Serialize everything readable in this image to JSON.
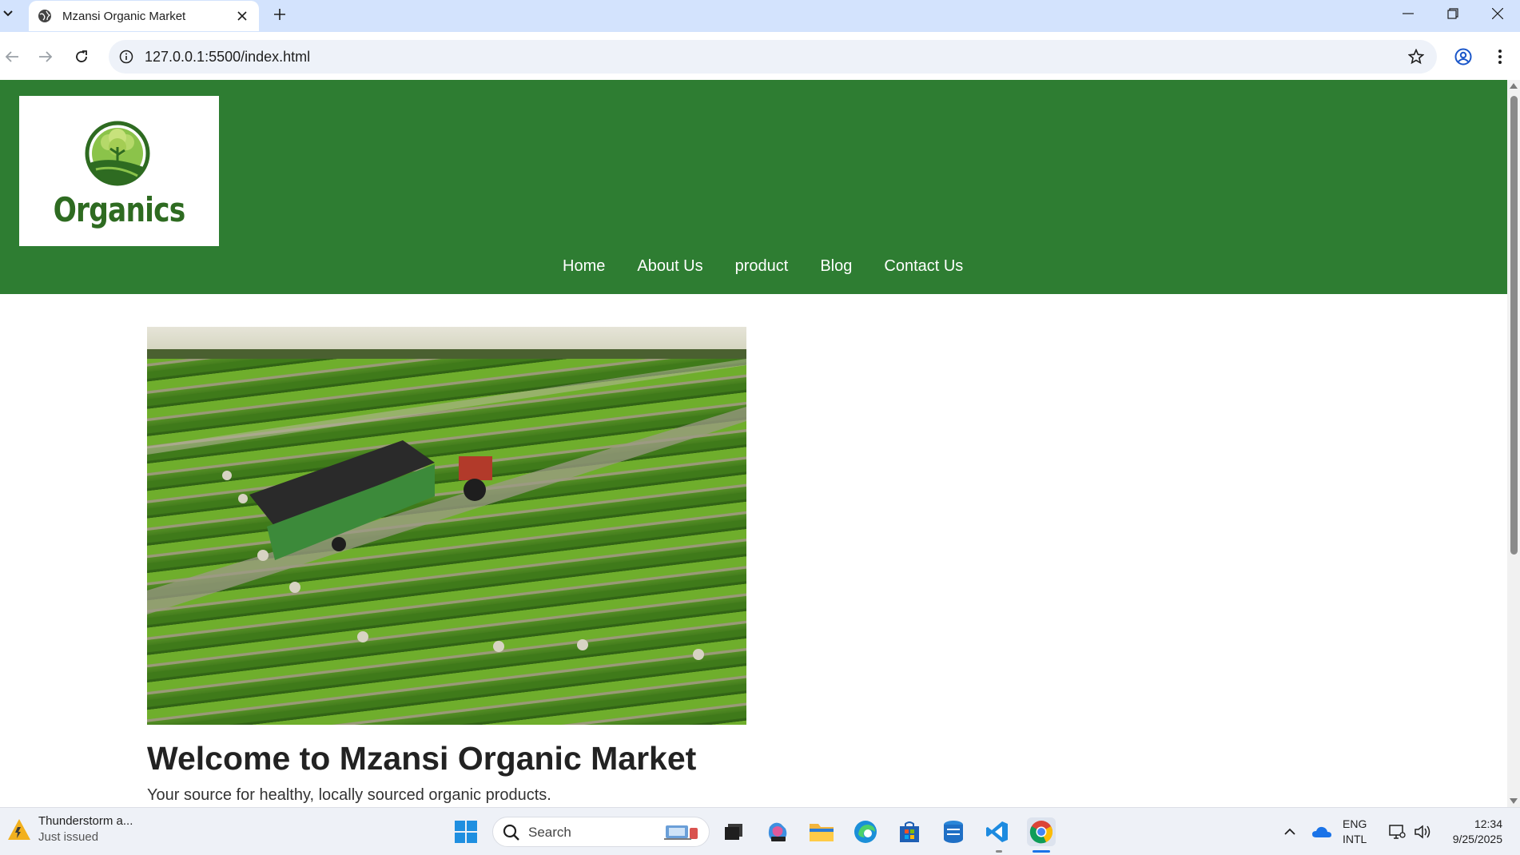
{
  "browser": {
    "tab_title": "Mzansi Organic Market",
    "url": "127.0.0.1:5500/index.html"
  },
  "site": {
    "logo_text": "Organics",
    "nav": [
      "Home",
      "About Us",
      "product",
      "Blog",
      "Contact Us"
    ],
    "welcome_heading": "Welcome to Mzansi Organic Market",
    "tagline": "Your source for healthy, locally sourced organic products.",
    "colors": {
      "header_green": "#2e7d32",
      "logo_green": "#2e6b21"
    }
  },
  "taskbar": {
    "notification_title": "Thunderstorm a...",
    "notification_subtitle": "Just issued",
    "search_placeholder": "Search",
    "language_top": "ENG",
    "language_bottom": "INTL",
    "time": "12:34",
    "date": "9/25/2025"
  }
}
